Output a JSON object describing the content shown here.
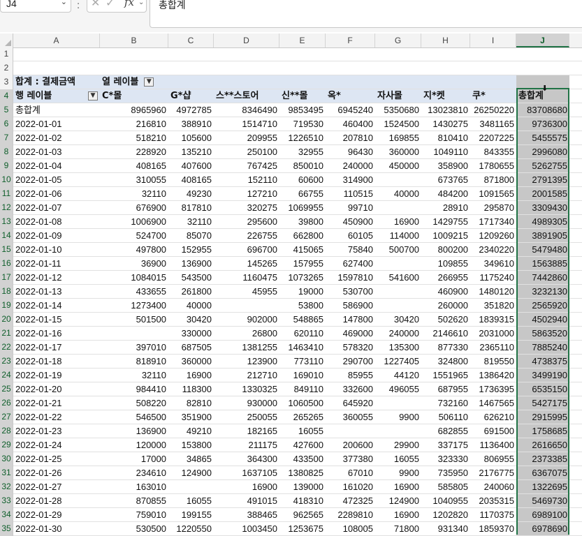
{
  "formula_bar": {
    "name_box": "J4",
    "name_box_dropdown_icon": "chevron-down-icon",
    "formula_content": "총합계",
    "cancel_icon": "✕",
    "enter_icon": "✓",
    "function_label": "fx"
  },
  "columns": [
    "A",
    "B",
    "C",
    "D",
    "E",
    "F",
    "G",
    "H",
    "I",
    "J"
  ],
  "selected_column": "J",
  "row_numbers": [
    "1",
    "2",
    "3",
    "4",
    "5",
    "6",
    "7",
    "8",
    "9",
    "10",
    "11",
    "12",
    "13",
    "14",
    "15",
    "16",
    "17",
    "18",
    "19",
    "20",
    "21",
    "22",
    "23",
    "24",
    "25",
    "26",
    "27",
    "28",
    "29",
    "30",
    "31",
    "32",
    "33",
    "34",
    "35"
  ],
  "pivot": {
    "value_label": "합계 : 결제금액",
    "column_labels_header": "열 레이블",
    "row_labels_header": "행 레이블",
    "column_headers": [
      "C*몰",
      "G*샵",
      "스**스토어",
      "신**몰",
      "옥*",
      "자사몰",
      "지*켓",
      "쿠*",
      "총합계"
    ],
    "grand_total_label": "총합계",
    "grand_total_row": [
      "8965960",
      "4972785",
      "8346490",
      "9853495",
      "6945240",
      "5350680",
      "13023810",
      "26250220",
      "83708680"
    ],
    "rows": [
      {
        "date": "2022-01-01",
        "values": [
          "216810",
          "388910",
          "1514710",
          "719530",
          "460400",
          "1524500",
          "1430275",
          "3481165",
          "9736300"
        ]
      },
      {
        "date": "2022-01-02",
        "values": [
          "518210",
          "105600",
          "209955",
          "1226510",
          "207810",
          "169855",
          "810410",
          "2207225",
          "5455575"
        ]
      },
      {
        "date": "2022-01-03",
        "values": [
          "228920",
          "135210",
          "250100",
          "32955",
          "96430",
          "360000",
          "1049110",
          "843355",
          "2996080"
        ]
      },
      {
        "date": "2022-01-04",
        "values": [
          "408165",
          "407600",
          "767425",
          "850010",
          "240000",
          "450000",
          "358900",
          "1780655",
          "5262755"
        ]
      },
      {
        "date": "2022-01-05",
        "values": [
          "310055",
          "408165",
          "152110",
          "60600",
          "314900",
          "",
          "673765",
          "871800",
          "2791395"
        ]
      },
      {
        "date": "2022-01-06",
        "values": [
          "32110",
          "49230",
          "127210",
          "66755",
          "110515",
          "40000",
          "484200",
          "1091565",
          "2001585"
        ]
      },
      {
        "date": "2022-01-07",
        "values": [
          "676900",
          "817810",
          "320275",
          "1069955",
          "99710",
          "",
          "28910",
          "295870",
          "3309430"
        ]
      },
      {
        "date": "2022-01-08",
        "values": [
          "1006900",
          "32110",
          "295600",
          "39800",
          "450900",
          "16900",
          "1429755",
          "1717340",
          "4989305"
        ]
      },
      {
        "date": "2022-01-09",
        "values": [
          "524700",
          "85070",
          "226755",
          "662800",
          "60105",
          "114000",
          "1009215",
          "1209260",
          "3891905"
        ]
      },
      {
        "date": "2022-01-10",
        "values": [
          "497800",
          "152955",
          "696700",
          "415065",
          "75840",
          "500700",
          "800200",
          "2340220",
          "5479480"
        ]
      },
      {
        "date": "2022-01-11",
        "values": [
          "36900",
          "136900",
          "145265",
          "157955",
          "627400",
          "",
          "109855",
          "349610",
          "1563885"
        ]
      },
      {
        "date": "2022-01-12",
        "values": [
          "1084015",
          "543500",
          "1160475",
          "1073265",
          "1597810",
          "541600",
          "266955",
          "1175240",
          "7442860"
        ]
      },
      {
        "date": "2022-01-13",
        "values": [
          "433655",
          "261800",
          "45955",
          "19000",
          "530700",
          "",
          "460900",
          "1480120",
          "3232130"
        ]
      },
      {
        "date": "2022-01-14",
        "values": [
          "1273400",
          "40000",
          "",
          "53800",
          "586900",
          "",
          "260000",
          "351820",
          "2565920"
        ]
      },
      {
        "date": "2022-01-15",
        "values": [
          "501500",
          "30420",
          "902000",
          "548865",
          "147800",
          "30420",
          "502620",
          "1839315",
          "4502940"
        ]
      },
      {
        "date": "2022-01-16",
        "values": [
          "",
          "330000",
          "26800",
          "620110",
          "469000",
          "240000",
          "2146610",
          "2031000",
          "5863520"
        ]
      },
      {
        "date": "2022-01-17",
        "values": [
          "397010",
          "687505",
          "1381255",
          "1463410",
          "578320",
          "135300",
          "877330",
          "2365110",
          "7885240"
        ]
      },
      {
        "date": "2022-01-18",
        "values": [
          "818910",
          "360000",
          "123900",
          "773110",
          "290700",
          "1227405",
          "324800",
          "819550",
          "4738375"
        ]
      },
      {
        "date": "2022-01-19",
        "values": [
          "32110",
          "16900",
          "212710",
          "169010",
          "85955",
          "44120",
          "1551965",
          "1386420",
          "3499190"
        ]
      },
      {
        "date": "2022-01-20",
        "values": [
          "984410",
          "118300",
          "1330325",
          "849110",
          "332600",
          "496055",
          "687955",
          "1736395",
          "6535150"
        ]
      },
      {
        "date": "2022-01-21",
        "values": [
          "508220",
          "82810",
          "930000",
          "1060500",
          "645920",
          "",
          "732160",
          "1467565",
          "5427175"
        ]
      },
      {
        "date": "2022-01-22",
        "values": [
          "546500",
          "351900",
          "250055",
          "265265",
          "360055",
          "9900",
          "506110",
          "626210",
          "2915995"
        ]
      },
      {
        "date": "2022-01-23",
        "values": [
          "136900",
          "49210",
          "182165",
          "16055",
          "",
          "",
          "682855",
          "691500",
          "1758685"
        ]
      },
      {
        "date": "2022-01-24",
        "values": [
          "120000",
          "153800",
          "211175",
          "427600",
          "200600",
          "29900",
          "337175",
          "1136400",
          "2616650"
        ]
      },
      {
        "date": "2022-01-25",
        "values": [
          "17000",
          "34865",
          "364300",
          "433500",
          "377380",
          "16055",
          "323330",
          "806955",
          "2373385"
        ]
      },
      {
        "date": "2022-01-26",
        "values": [
          "234610",
          "124900",
          "1637105",
          "1380825",
          "67010",
          "9900",
          "735950",
          "2176775",
          "6367075"
        ]
      },
      {
        "date": "2022-01-27",
        "values": [
          "163010",
          "",
          "16900",
          "139000",
          "161020",
          "16900",
          "585805",
          "240060",
          "1322695"
        ]
      },
      {
        "date": "2022-01-28",
        "values": [
          "870855",
          "16055",
          "491015",
          "418310",
          "472325",
          "124900",
          "1040955",
          "2035315",
          "5469730"
        ]
      },
      {
        "date": "2022-01-29",
        "values": [
          "759010",
          "199155",
          "388465",
          "962565",
          "2289810",
          "16900",
          "1202820",
          "1170375",
          "6989100"
        ]
      },
      {
        "date": "2022-01-30",
        "values": [
          "530500",
          "1220550",
          "1003450",
          "1253675",
          "108005",
          "71800",
          "931340",
          "1859370",
          "6978690"
        ]
      }
    ]
  },
  "colors": {
    "selection": "#217346",
    "pivot_band": "#dde6f3",
    "selected_fill": "#c7c7c7"
  }
}
